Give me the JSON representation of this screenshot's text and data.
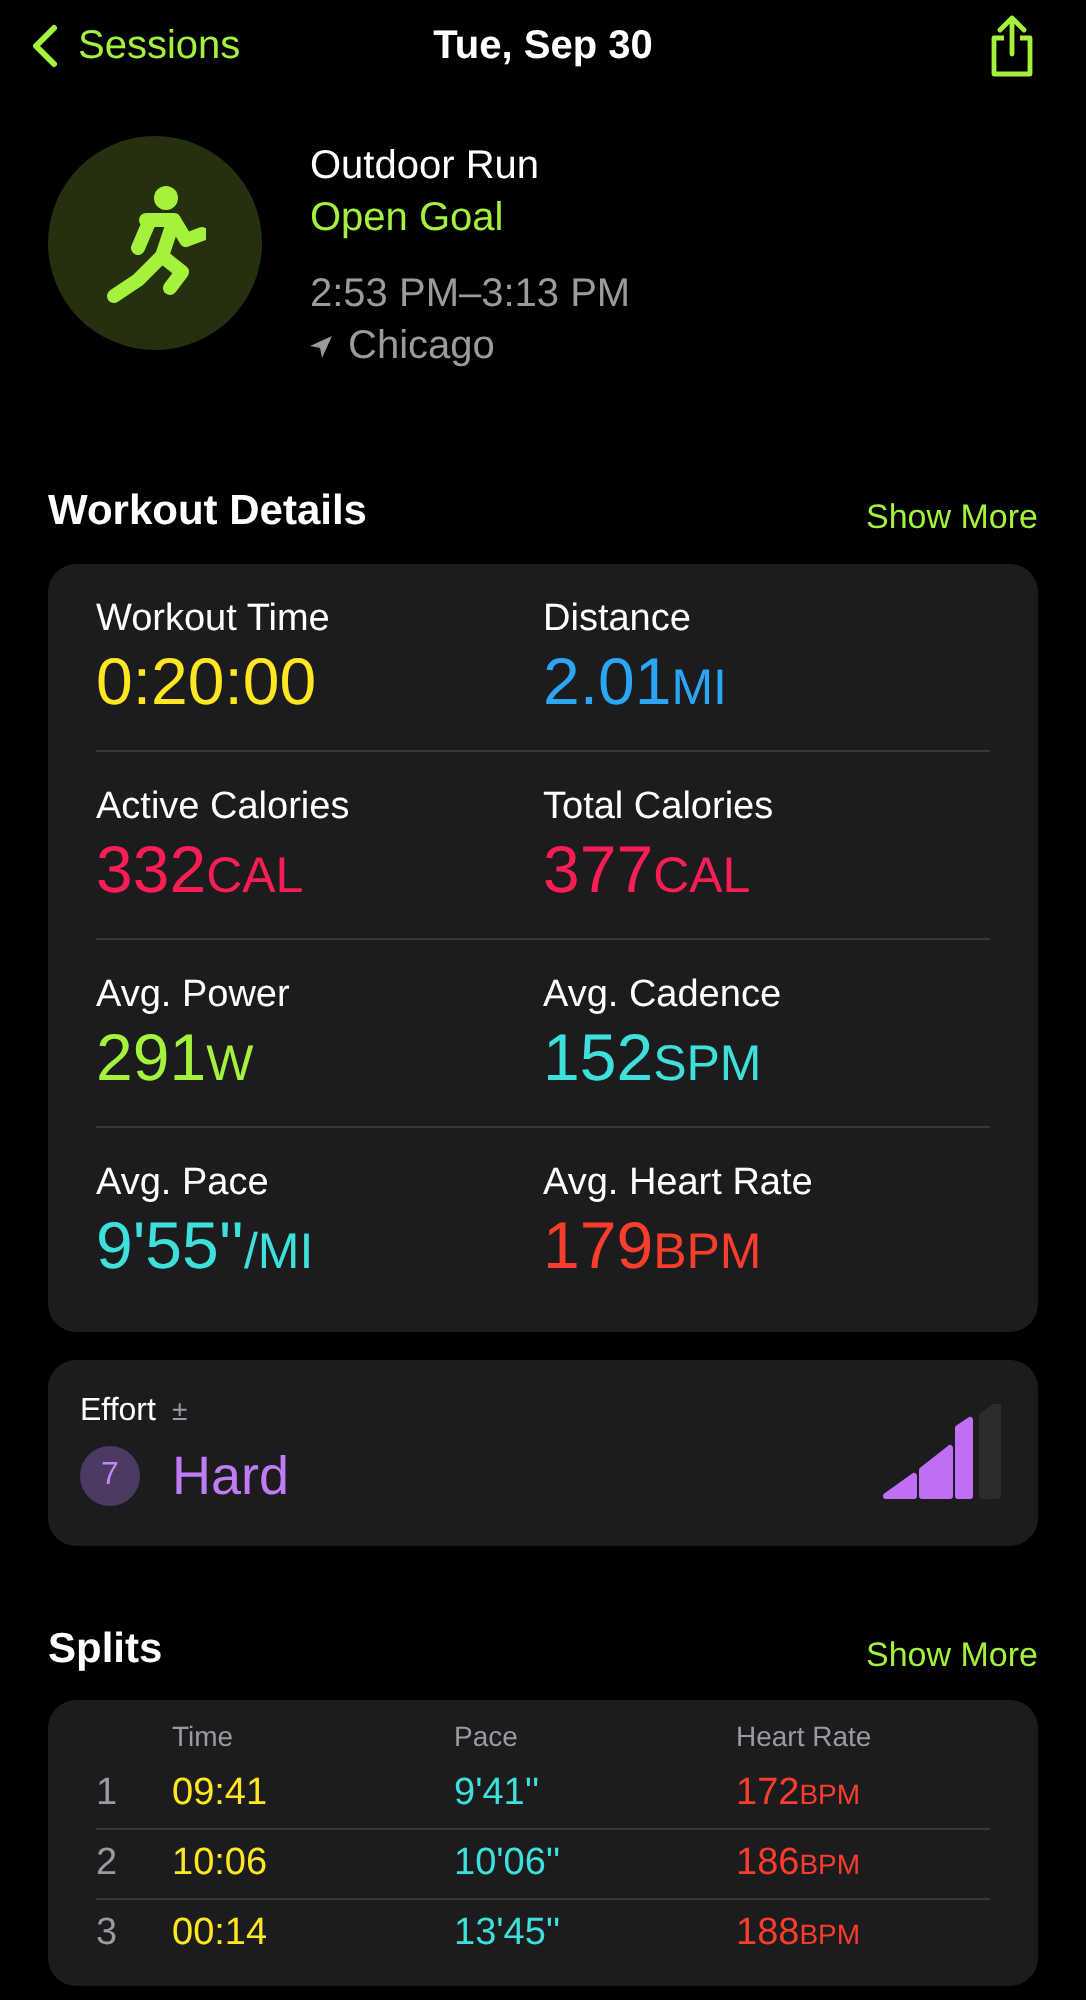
{
  "nav": {
    "back": "Sessions",
    "title": "Tue, Sep 30"
  },
  "workout": {
    "name": "Outdoor Run",
    "goal": "Open Goal",
    "time_range": "2:53 PM–3:13 PM",
    "location": "Chicago"
  },
  "details": {
    "title": "Workout Details",
    "action": "Show More",
    "metrics": [
      {
        "label": "Workout Time",
        "value": "0:20:00",
        "color": "#ffe620"
      },
      {
        "label": "Distance",
        "value": "2.01",
        "unit": "MI",
        "color": "#2aa6f5"
      },
      {
        "label": "Active Calories",
        "value": "332",
        "unit": "CAL",
        "color": "#fa1d53"
      },
      {
        "label": "Total Calories",
        "value": "377",
        "unit": "CAL",
        "color": "#fa1d53"
      },
      {
        "label": "Avg. Power",
        "value": "291",
        "unit": "W",
        "color": "#a4f23c"
      },
      {
        "label": "Avg. Cadence",
        "value": "152",
        "unit": "SPM",
        "color": "#3ee0dc"
      },
      {
        "label": "Avg. Pace",
        "value": "9'55''",
        "unit": "/MI",
        "color": "#3ee0dc"
      },
      {
        "label": "Avg. Heart Rate",
        "value": "179",
        "unit": "BPM",
        "color": "#fa3d2a"
      }
    ]
  },
  "effort": {
    "label": "Effort",
    "adjust": "±",
    "score": "7",
    "rating": "Hard",
    "level": 0.75
  },
  "splits": {
    "title": "Splits",
    "action": "Show More",
    "columns": [
      "Time",
      "Pace",
      "Heart Rate"
    ],
    "rows": [
      {
        "index": "1",
        "time": "09:41",
        "pace": "9'41''",
        "heart_rate": "172",
        "unit": "BPM"
      },
      {
        "index": "2",
        "time": "10:06",
        "pace": "10'06''",
        "heart_rate": "186",
        "unit": "BPM"
      },
      {
        "index": "3",
        "time": "00:14",
        "pace": "13'45''",
        "heart_rate": "188",
        "unit": "BPM"
      }
    ]
  }
}
